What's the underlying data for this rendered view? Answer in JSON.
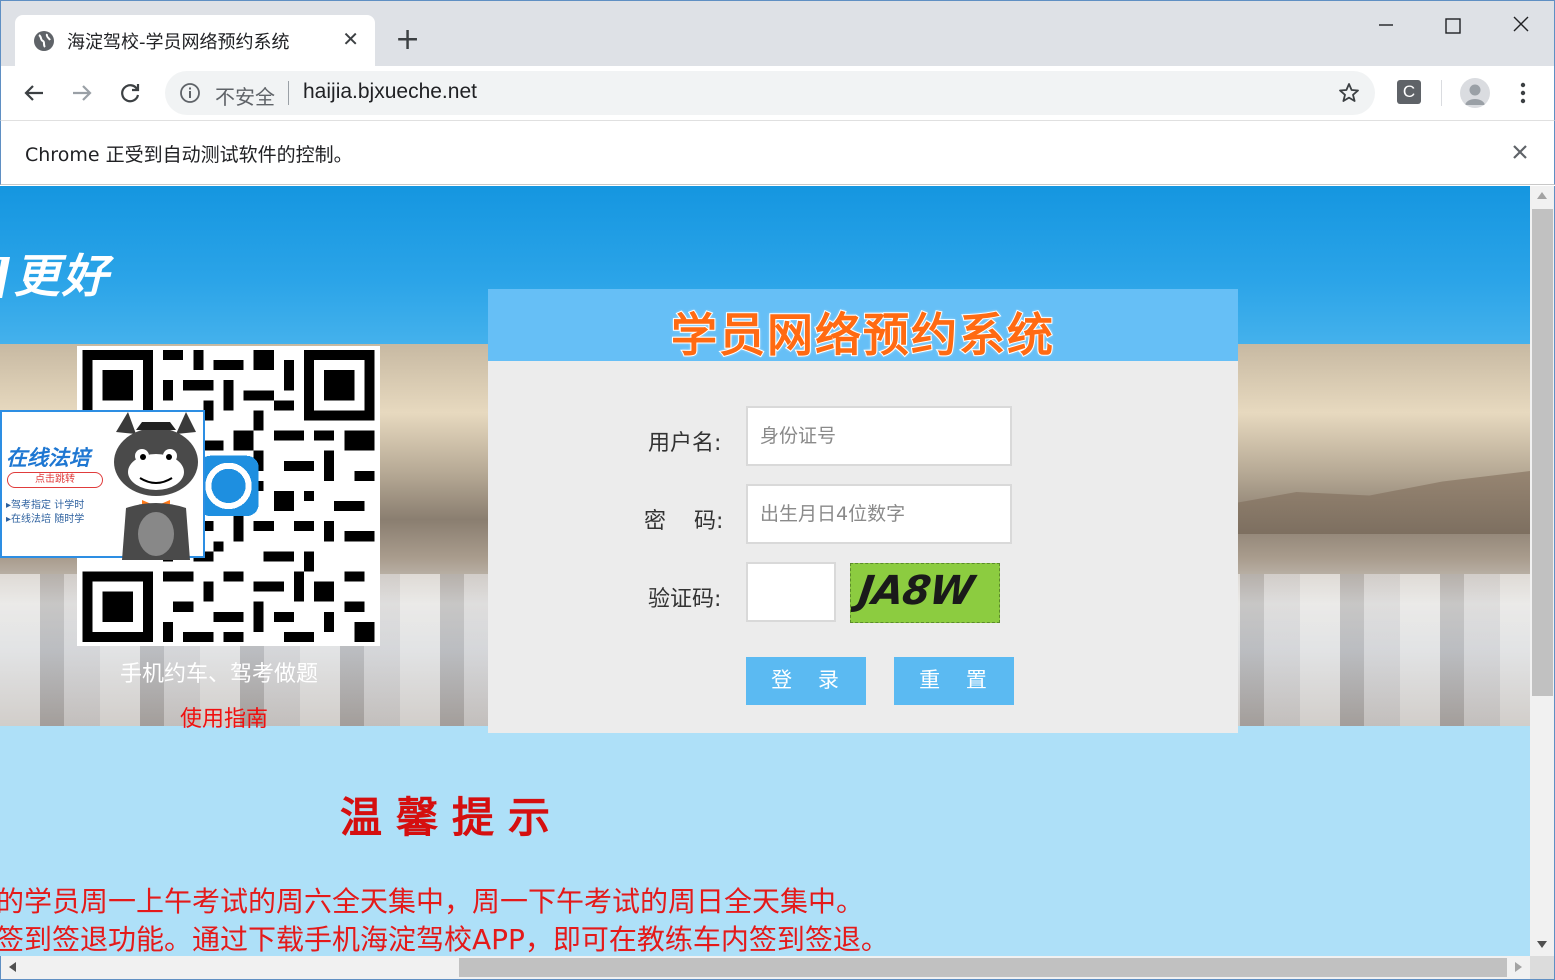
{
  "browser": {
    "tab_title": "海淀驾校-学员网络预约系统",
    "tab_icon": "globe-icon",
    "insecure_label": "不安全",
    "url": "haijia.bjxueche.net",
    "extension_letter": "C",
    "automation_notice": "Chrome 正受到自动测试软件的控制。"
  },
  "banner": {
    "slogan": "]更好",
    "app_caption": "手机约车、驾考做题",
    "guide_link": "使用指南"
  },
  "promo": {
    "title": "在线法培",
    "button": "点击跳转",
    "line1": "▸驾考指定  计学时",
    "line2": "▸在线法培  随时学"
  },
  "login": {
    "title": "学员网络预约系统",
    "username_label": "用户名:",
    "username_placeholder": "身份证号",
    "password_label": "密    码:",
    "password_placeholder": "出生月日4位数字",
    "captcha_label": "验证码:",
    "captcha_value": "",
    "captcha_text": "JA8W",
    "login_button": "登 录",
    "reset_button": "重 置",
    "accent_color": "#66bff6",
    "title_color": "#ff6a12"
  },
  "tips": {
    "title": "温馨提示",
    "line1": "的学员周一上午考试的周六全天集中，周一下午考试的周日全天集中。",
    "line2": "签到签退功能。通过下载手机海淀驾校APP，即可在教练车内签到签退。",
    "color": "#e41a1a"
  }
}
